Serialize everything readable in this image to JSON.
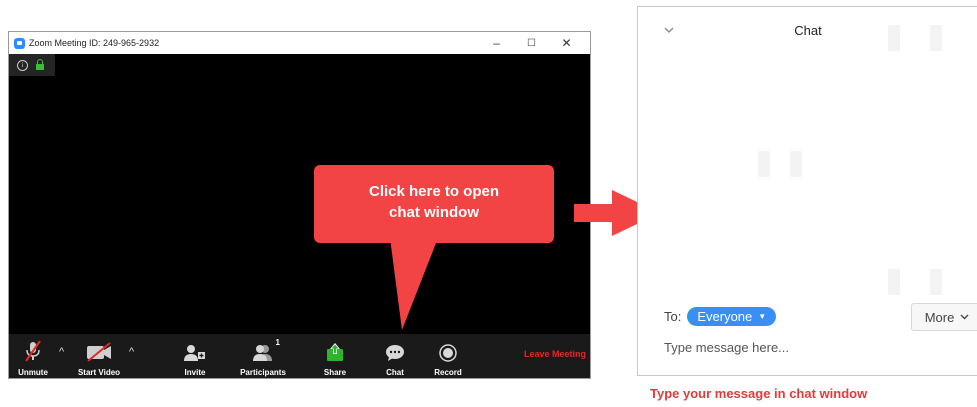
{
  "window": {
    "title": "Zoom Meeting ID: 249-965-2932",
    "controls": {
      "minimize": "–",
      "maximize": "☐",
      "close": "✕"
    }
  },
  "toolbar": {
    "unmute": "Unmute",
    "start_video": "Start Video",
    "invite": "Invite",
    "participants": "Participants",
    "participants_count": "1",
    "share": "Share",
    "chat": "Chat",
    "record": "Record",
    "leave": "Leave Meeting",
    "caret": "^"
  },
  "callout": {
    "line1": "Click here to open",
    "line2": "chat window"
  },
  "chat": {
    "title": "Chat",
    "to_label": "To:",
    "recipient": "Everyone",
    "more_label": "More",
    "input_placeholder": "Type message here..."
  },
  "caption": "Type your message in chat window",
  "colors": {
    "callout": "#f24444",
    "accent": "#3a8ef6",
    "leave": "#e02828",
    "share": "#2db52d"
  }
}
